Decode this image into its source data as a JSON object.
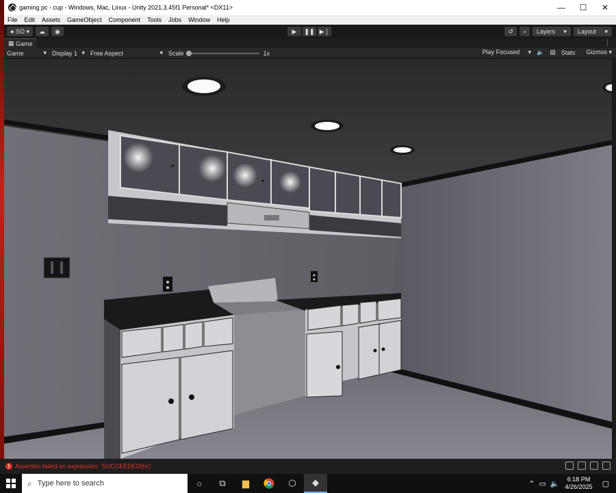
{
  "window": {
    "title": "gaming pc - cup - Windows, Mac, Linux - Unity 2021.3.45f1 Personal* <DX11>",
    "minimize": "—",
    "maximize": "☐",
    "close": "✕"
  },
  "menu": [
    "File",
    "Edit",
    "Assets",
    "GameObject",
    "Component",
    "Tools",
    "Jobs",
    "Window",
    "Help"
  ],
  "toolbar": {
    "account_label": "SO",
    "layers_label": "Layers",
    "layout_label": "Layout"
  },
  "tab": {
    "label": "Game"
  },
  "game_controls": {
    "mode": "Game",
    "display": "Display 1",
    "aspect": "Free Aspect",
    "scale_label": "Scale",
    "scale_value": "1x",
    "scale_fraction": 0.0,
    "play_mode": "Play Focused",
    "stats": "Stats",
    "gizmos": "Gizmos"
  },
  "console": {
    "error": "Assertion failed on expression: 'SUCCEEDED(hr)'"
  },
  "taskbar": {
    "search_placeholder": "Type here to search",
    "time": "6:18 PM",
    "date": "4/26/2025"
  },
  "colors": {
    "accent_error": "#e0342a",
    "editor_dark": "#191919"
  }
}
